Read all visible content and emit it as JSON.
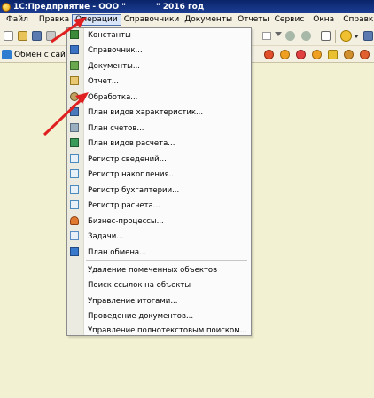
{
  "window": {
    "title_left": "1С:Предприятие - ООО \"",
    "title_right": "\" 2016 год"
  },
  "menubar": {
    "items": [
      "Файл",
      "Правка",
      "Операции",
      "Справочники",
      "Документы",
      "Отчеты",
      "Сервис",
      "Окна",
      "Справка"
    ],
    "active": "Операции"
  },
  "toolbar2": {
    "exchange_label": "Обмен с сайто"
  },
  "dropdown": {
    "items": [
      {
        "label": "Константы",
        "icon": "constants-icon",
        "color": "#3a8a3a"
      },
      {
        "label": "Справочник...",
        "icon": "catalog-icon",
        "color": "#3b73c4"
      },
      {
        "label": "Документы...",
        "icon": "documents-icon",
        "color": "#6aa84f"
      },
      {
        "label": "Отчет...",
        "icon": "report-icon",
        "color": "#b8860b"
      },
      {
        "label": "Обработка...",
        "icon": "processing-icon",
        "color": "#8a6a2a"
      },
      {
        "label": "План видов характеристик...",
        "icon": "characteristics-plan-icon",
        "color": "#4a7abc"
      },
      {
        "label": "План счетов...",
        "icon": "accounts-plan-icon",
        "color": "#7a9ab0"
      },
      {
        "label": "План видов расчета...",
        "icon": "calculation-plan-icon",
        "color": "#3a9a5a"
      },
      {
        "label": "Регистр сведений...",
        "icon": "info-register-icon",
        "color": "#4a8abc"
      },
      {
        "label": "Регистр накопления...",
        "icon": "accumulation-register-icon",
        "color": "#4a8abc"
      },
      {
        "label": "Регистр бухгалтерии...",
        "icon": "accounting-register-icon",
        "color": "#4a8abc"
      },
      {
        "label": "Регистр расчета...",
        "icon": "calculation-register-icon",
        "color": "#4a8abc"
      },
      {
        "label": "Бизнес-процессы...",
        "icon": "business-process-icon",
        "color": "#d2691e"
      },
      {
        "label": "Задачи...",
        "icon": "tasks-icon",
        "color": "#5a8ac4"
      },
      {
        "label": "План обмена...",
        "icon": "exchange-plan-icon",
        "color": "#3a7acc"
      }
    ],
    "service_items": [
      "Удаление помеченных объектов",
      "Поиск ссылок на объекты",
      "Управление итогами...",
      "Проведение документов...",
      "Управление полнотекстовым поиском..."
    ]
  },
  "annotation": {
    "arrow_color": "#e02020"
  }
}
